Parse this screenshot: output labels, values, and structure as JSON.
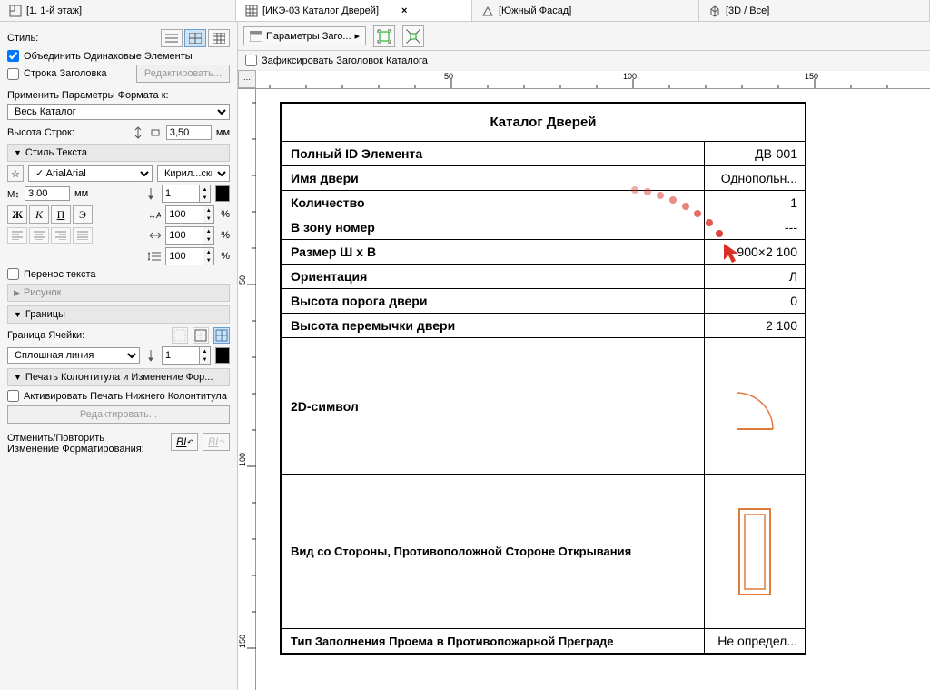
{
  "tabs": [
    {
      "label": "[1. 1-й этаж]"
    },
    {
      "label": "[ИКЭ-03 Каталог Дверей]"
    },
    {
      "label": "[Южный Фасад]"
    },
    {
      "label": "[3D / Все]"
    }
  ],
  "sidebar": {
    "style_label": "Стиль:",
    "merge_same": "Объединить Одинаковые Элементы",
    "header_row": "Строка Заголовка",
    "edit": "Редактировать...",
    "apply_params": "Применить Параметры Формата к:",
    "whole_catalog": "Весь Каталог",
    "row_height_label": "Высота Строк:",
    "row_height_value": "3,50",
    "mm": "мм",
    "text_style": "Стиль Текста",
    "font": "Arial",
    "encoding": "Кирил...ский",
    "size_mm": "3,00",
    "pen_width": "1",
    "spacing1": "100",
    "spacing2": "100",
    "spacing3": "100",
    "wrap_text": "Перенос текста",
    "drawing": "Рисунок",
    "borders": "Границы",
    "cell_border_label": "Граница Ячейки:",
    "line_type": "Сплошная линия",
    "border_pen": "1",
    "footer_section": "Печать Колонтитула и Изменение Фор...",
    "activate_footer": "Активировать Печать Нижнего Колонтитула",
    "edit2": "Редактировать...",
    "undo_label1": "Отменить/Повторить",
    "undo_label2": "Изменение Форматирования:",
    "bi_icon": "B/"
  },
  "toolbar": {
    "params_btn": "Параметры Заго..."
  },
  "fixheader": "Зафиксировать Заголовок Каталога",
  "ruler": {
    "t50": "50",
    "t100": "100",
    "t150": "150",
    "v50": "50",
    "v100": "100",
    "v150": "150"
  },
  "catalog": {
    "title": "Каталог Дверей",
    "rows": [
      {
        "label": "Полный ID Элемента",
        "value": "ДВ-001"
      },
      {
        "label": "Имя двери",
        "value": "Однопольн..."
      },
      {
        "label": "Количество",
        "value": "1"
      },
      {
        "label": "В зону номер",
        "value": "---"
      },
      {
        "label": "Размер Ш x В",
        "value": "900×2 100"
      },
      {
        "label": "Ориентация",
        "value": "Л"
      },
      {
        "label": "Высота порога двери",
        "value": "0"
      },
      {
        "label": "Высота перемычки двери",
        "value": "2 100"
      }
    ],
    "symbol2d": "2D-символ",
    "view_label": "Вид со Стороны, Противоположной Стороне Открывания",
    "fill_type_label": "Тип Заполнения Проема в Противопожарной Преграде",
    "fill_type_value": "Не определ..."
  }
}
